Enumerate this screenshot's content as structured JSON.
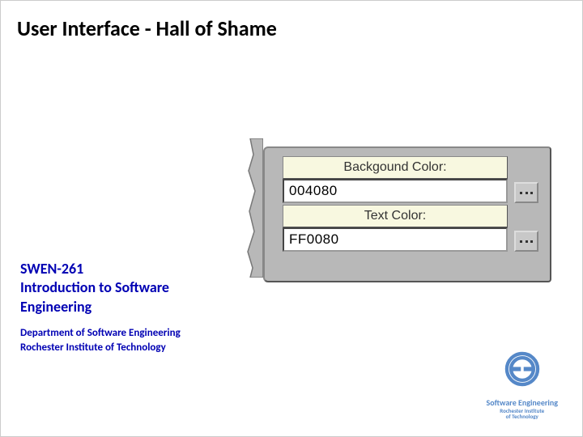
{
  "title": "User Interface - Hall of Shame",
  "course": {
    "code": "SWEN-261",
    "name": "Introduction to Software Engineering",
    "dept_line1": "Department of Software Engineering",
    "dept_line2": "Rochester Institute of Technology"
  },
  "panel": {
    "bg_label": "Backgound Color:",
    "bg_value": "004080",
    "text_label": "Text Color:",
    "text_value": "FF0080"
  },
  "logo": {
    "line1": "Software Engineering",
    "line2": "Rochester Institute",
    "line3": "of Technology"
  }
}
